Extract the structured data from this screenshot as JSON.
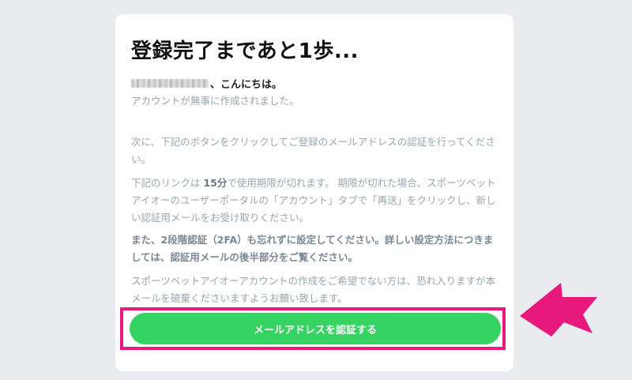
{
  "card": {
    "title": "登録完了まであと1歩...",
    "greeting_suffix": "、こんにちは。",
    "paragraphs": {
      "created": "アカウントが無事に作成されました。",
      "next": "次に、下記のボタンをクリックしてご登録のメールアドレスの認証を行ってください。",
      "link_prefix": "下記のリンクは ",
      "link_duration": "15分",
      "link_suffix": "で使用期限が切れます。 期限が切れた場合、スポーツベットアイオーのユーザーポータルの「アカウント」タブで「再送」をクリックし、新しい認証用メールをお受け取りください。",
      "twofa": "また、2段階認証（2FA）も忘れずに設定してください。詳しい設定方法につきましては、認証用メールの後半部分をご覧ください。",
      "ignore": "スポーツベットアイオーアカウントの作成をご希望でない方は、恐れ入りますが本メールを破棄くださいますようお願い致します。"
    },
    "verify_button": "メールアドレスを認証する"
  },
  "colors": {
    "background": "#e9ebef",
    "card": "#ffffff",
    "button": "#35d462",
    "highlight": "#e8197d",
    "muted_text": "#9aa5b1"
  },
  "icons": {
    "annotation": "pink-arrow-pointer-icon"
  }
}
